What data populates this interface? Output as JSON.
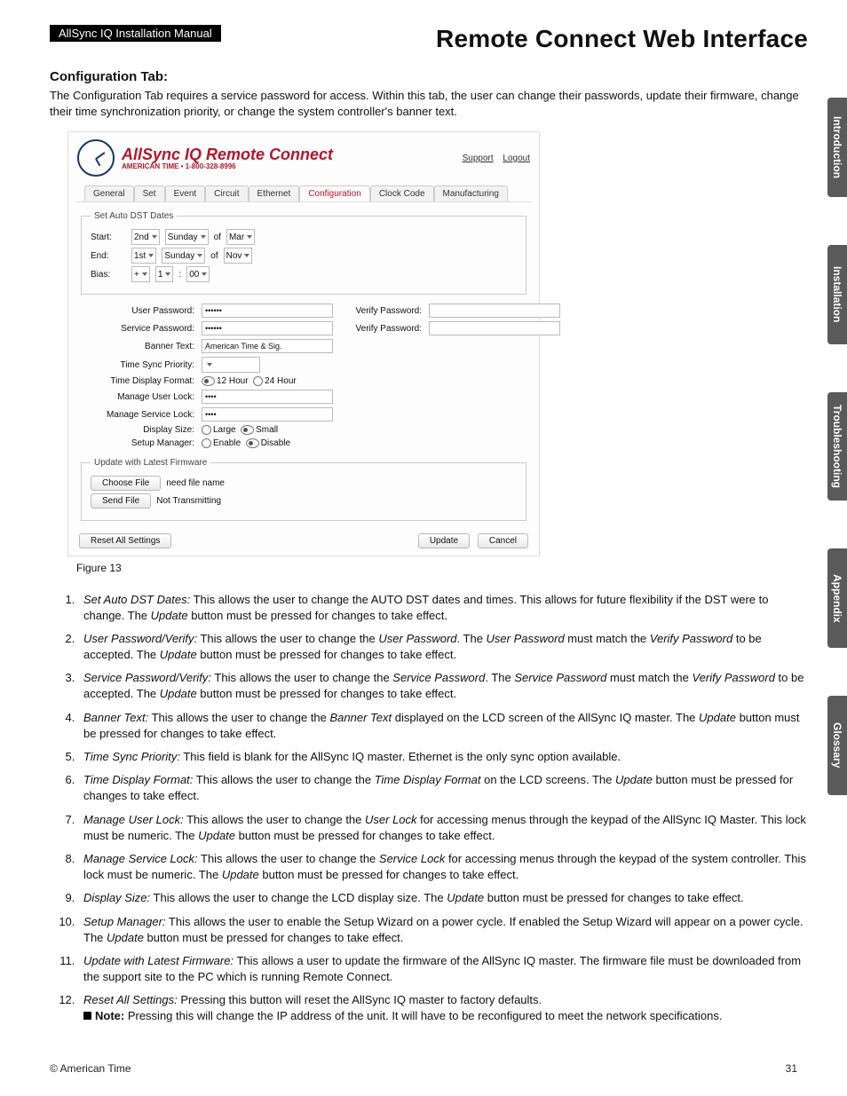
{
  "header": {
    "badge": "AllSync IQ Installation Manual",
    "title": "Remote Connect Web Interface"
  },
  "section": {
    "heading": "Configuration Tab:",
    "intro": "The Configuration Tab requires a service password for access. Within this tab, the user can change their passwords, update their firmware, change their time synchronization priority, or change the system controller's banner text."
  },
  "shot": {
    "logo_main": "AllSync IQ Remote Connect",
    "logo_sub": "AMERICAN TIME • 1-800-328-8996",
    "links": {
      "support": "Support",
      "logout": "Logout"
    },
    "tabs": [
      "General",
      "Set",
      "Event",
      "Circuit",
      "Ethernet",
      "Configuration",
      "Clock Code",
      "Manufacturing"
    ],
    "active_tab_index": 5,
    "dst": {
      "legend": "Set Auto DST Dates",
      "start_label": "Start:",
      "end_label": "End:",
      "bias_label": "Bias:",
      "of": "of",
      "start": {
        "ord": "2nd",
        "day": "Sunday",
        "month": "Mar"
      },
      "end": {
        "ord": "1st",
        "day": "Sunday",
        "month": "Nov"
      },
      "bias": {
        "sign": "+",
        "hours": "1",
        "sep": ":",
        "mins": "00"
      }
    },
    "form": {
      "user_pw_label": "User Password:",
      "user_pw_value": "••••••",
      "service_pw_label": "Service Password:",
      "service_pw_value": "••••••",
      "verify_pw_label": "Verify Password:",
      "banner_label": "Banner Text:",
      "banner_value": "American Time & Sig.",
      "tsp_label": "Time Sync Priority:",
      "tdf_label": "Time Display Format:",
      "tdf_12": "12 Hour",
      "tdf_24": "24 Hour",
      "mul_label": "Manage User Lock:",
      "mul_value": "••••",
      "msl_label": "Manage Service Lock:",
      "msl_value": "••••",
      "ds_label": "Display Size:",
      "ds_large": "Large",
      "ds_small": "Small",
      "sm_label": "Setup Manager:",
      "sm_enable": "Enable",
      "sm_disable": "Disable"
    },
    "fw": {
      "legend": "Update with Latest Firmware",
      "choose": "Choose File",
      "choose_status": "need file name",
      "send": "Send File",
      "send_status": "Not Transmitting"
    },
    "buttons": {
      "reset": "Reset All Settings",
      "update": "Update",
      "cancel": "Cancel"
    }
  },
  "figcap": "Figure 13",
  "list": [
    {
      "lead": "Set Auto DST Dates:",
      "rest": " This allows the user to change the AUTO DST dates and times. This allows for future flexibility if the DST were to change. The ",
      "it2": "Update",
      "rest2": " button must be pressed for changes to take effect."
    },
    {
      "lead": "User Password/Verify:",
      "rest": " This allows the user to change the ",
      "it2": "User Password",
      "rest2": ". The ",
      "it3": "User Password",
      "rest3": " must match the ",
      "it4": "Verify Password",
      "rest4": " to be accepted. The ",
      "it5": "Update",
      "rest5": " button must be pressed for changes to take effect."
    },
    {
      "lead": "Service Password/Verify:",
      "rest": " This allows the user to change the ",
      "it2": "Service Password",
      "rest2": ". The ",
      "it3": "Service Password",
      "rest3": " must match the ",
      "it4": "Verify Password",
      "rest4": " to be accepted. The ",
      "it5": "Update",
      "rest5": " button must be pressed for changes to take effect."
    },
    {
      "lead": "Banner Text:",
      "rest": " This allows the user to change the ",
      "it2": "Banner Text",
      "rest2": " displayed on the LCD screen of the AllSync IQ master. The ",
      "it3": "Update",
      "rest3": " button must be pressed for changes to take effect."
    },
    {
      "lead": "Time Sync Priority:",
      "rest": " This field is blank for the AllSync IQ master. Ethernet is the only sync option available."
    },
    {
      "lead": "Time Display Format:",
      "rest": " This allows the user to change the ",
      "it2": "Time Display Format",
      "rest2": " on the LCD screens. The ",
      "it3": "Update",
      "rest3": " button must be pressed for changes to take effect."
    },
    {
      "lead": "Manage User Lock:",
      "rest": " This allows the user to change the ",
      "it2": "User Lock",
      "rest2": " for accessing menus through the keypad of the AllSync IQ Master. This lock must be numeric. The ",
      "it3": "Update",
      "rest3": " button must be pressed for changes to take effect."
    },
    {
      "lead": "Manage Service Lock:",
      "rest": " This allows the user to change the ",
      "it2": "Service Lock",
      "rest2": " for accessing menus through the keypad of the system controller. This lock must be numeric. The ",
      "it3": "Update",
      "rest3": " button must be pressed for changes to take effect."
    },
    {
      "lead": "Display Size:",
      "rest": " This allows the user to change the LCD display size. The ",
      "it2": "Update",
      "rest2": " button must be pressed for changes to take effect."
    },
    {
      "lead": "Setup Manager:",
      "rest": " This allows the user to enable the Setup Wizard on a power cycle. If enabled the Setup Wizard will appear on a power cycle. The ",
      "it2": "Update",
      "rest2": " button must be pressed for changes to take effect."
    },
    {
      "lead": "Update with Latest Firmware:",
      "rest": " This allows a user to update the firmware of the AllSync IQ master. The firmware file must be downloaded from the support site to the PC which is running Remote Connect."
    },
    {
      "lead": "Reset All Settings:",
      "rest": " Pressing this button will reset the AllSync IQ master to factory defaults.",
      "note_label": "Note:",
      "note_rest": " Pressing this will change the IP address of the unit. It will have to be reconfigured to meet the network specifications."
    }
  ],
  "side_tabs": [
    "Introduction",
    "Installation",
    "Troubleshooting",
    "Appendix",
    "Glossary"
  ],
  "footer": {
    "copyright": "© American Time",
    "page": "31"
  }
}
